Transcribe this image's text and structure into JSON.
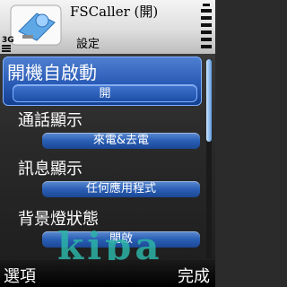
{
  "header": {
    "title": "FSCaller (開)",
    "subtitle": "設定",
    "network": "3G"
  },
  "settings": [
    {
      "label": "開機自啟動",
      "value": "開"
    },
    {
      "label": "通話顯示",
      "value": "來電&去電"
    },
    {
      "label": "訊息顯示",
      "value": "任何應用程式"
    },
    {
      "label": "背景燈狀態",
      "value": "開啟"
    }
  ],
  "softkeys": {
    "left": "選項",
    "right": "完成"
  },
  "watermark": "kipa",
  "colors": {
    "accent": "#2a5fb5",
    "highlight": "#7fb0ff",
    "logo": "#2cb3a7"
  }
}
